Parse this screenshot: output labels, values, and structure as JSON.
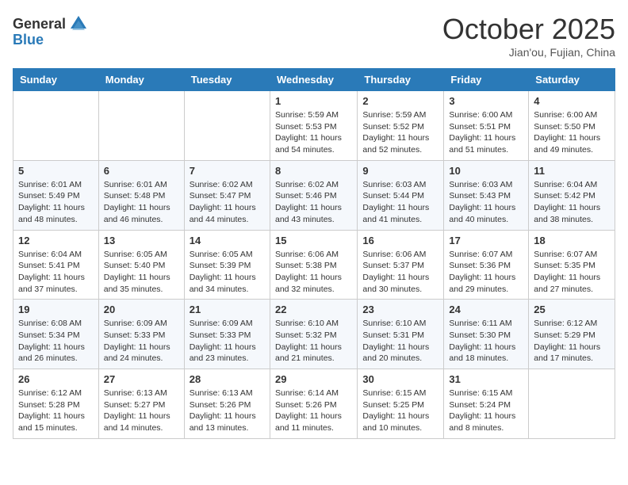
{
  "header": {
    "logo_general": "General",
    "logo_blue": "Blue",
    "month": "October 2025",
    "location": "Jian'ou, Fujian, China"
  },
  "weekdays": [
    "Sunday",
    "Monday",
    "Tuesday",
    "Wednesday",
    "Thursday",
    "Friday",
    "Saturday"
  ],
  "weeks": [
    [
      null,
      null,
      null,
      {
        "day": "1",
        "sunrise": "Sunrise: 5:59 AM",
        "sunset": "Sunset: 5:53 PM",
        "daylight": "Daylight: 11 hours and 54 minutes."
      },
      {
        "day": "2",
        "sunrise": "Sunrise: 5:59 AM",
        "sunset": "Sunset: 5:52 PM",
        "daylight": "Daylight: 11 hours and 52 minutes."
      },
      {
        "day": "3",
        "sunrise": "Sunrise: 6:00 AM",
        "sunset": "Sunset: 5:51 PM",
        "daylight": "Daylight: 11 hours and 51 minutes."
      },
      {
        "day": "4",
        "sunrise": "Sunrise: 6:00 AM",
        "sunset": "Sunset: 5:50 PM",
        "daylight": "Daylight: 11 hours and 49 minutes."
      }
    ],
    [
      {
        "day": "5",
        "sunrise": "Sunrise: 6:01 AM",
        "sunset": "Sunset: 5:49 PM",
        "daylight": "Daylight: 11 hours and 48 minutes."
      },
      {
        "day": "6",
        "sunrise": "Sunrise: 6:01 AM",
        "sunset": "Sunset: 5:48 PM",
        "daylight": "Daylight: 11 hours and 46 minutes."
      },
      {
        "day": "7",
        "sunrise": "Sunrise: 6:02 AM",
        "sunset": "Sunset: 5:47 PM",
        "daylight": "Daylight: 11 hours and 44 minutes."
      },
      {
        "day": "8",
        "sunrise": "Sunrise: 6:02 AM",
        "sunset": "Sunset: 5:46 PM",
        "daylight": "Daylight: 11 hours and 43 minutes."
      },
      {
        "day": "9",
        "sunrise": "Sunrise: 6:03 AM",
        "sunset": "Sunset: 5:44 PM",
        "daylight": "Daylight: 11 hours and 41 minutes."
      },
      {
        "day": "10",
        "sunrise": "Sunrise: 6:03 AM",
        "sunset": "Sunset: 5:43 PM",
        "daylight": "Daylight: 11 hours and 40 minutes."
      },
      {
        "day": "11",
        "sunrise": "Sunrise: 6:04 AM",
        "sunset": "Sunset: 5:42 PM",
        "daylight": "Daylight: 11 hours and 38 minutes."
      }
    ],
    [
      {
        "day": "12",
        "sunrise": "Sunrise: 6:04 AM",
        "sunset": "Sunset: 5:41 PM",
        "daylight": "Daylight: 11 hours and 37 minutes."
      },
      {
        "day": "13",
        "sunrise": "Sunrise: 6:05 AM",
        "sunset": "Sunset: 5:40 PM",
        "daylight": "Daylight: 11 hours and 35 minutes."
      },
      {
        "day": "14",
        "sunrise": "Sunrise: 6:05 AM",
        "sunset": "Sunset: 5:39 PM",
        "daylight": "Daylight: 11 hours and 34 minutes."
      },
      {
        "day": "15",
        "sunrise": "Sunrise: 6:06 AM",
        "sunset": "Sunset: 5:38 PM",
        "daylight": "Daylight: 11 hours and 32 minutes."
      },
      {
        "day": "16",
        "sunrise": "Sunrise: 6:06 AM",
        "sunset": "Sunset: 5:37 PM",
        "daylight": "Daylight: 11 hours and 30 minutes."
      },
      {
        "day": "17",
        "sunrise": "Sunrise: 6:07 AM",
        "sunset": "Sunset: 5:36 PM",
        "daylight": "Daylight: 11 hours and 29 minutes."
      },
      {
        "day": "18",
        "sunrise": "Sunrise: 6:07 AM",
        "sunset": "Sunset: 5:35 PM",
        "daylight": "Daylight: 11 hours and 27 minutes."
      }
    ],
    [
      {
        "day": "19",
        "sunrise": "Sunrise: 6:08 AM",
        "sunset": "Sunset: 5:34 PM",
        "daylight": "Daylight: 11 hours and 26 minutes."
      },
      {
        "day": "20",
        "sunrise": "Sunrise: 6:09 AM",
        "sunset": "Sunset: 5:33 PM",
        "daylight": "Daylight: 11 hours and 24 minutes."
      },
      {
        "day": "21",
        "sunrise": "Sunrise: 6:09 AM",
        "sunset": "Sunset: 5:33 PM",
        "daylight": "Daylight: 11 hours and 23 minutes."
      },
      {
        "day": "22",
        "sunrise": "Sunrise: 6:10 AM",
        "sunset": "Sunset: 5:32 PM",
        "daylight": "Daylight: 11 hours and 21 minutes."
      },
      {
        "day": "23",
        "sunrise": "Sunrise: 6:10 AM",
        "sunset": "Sunset: 5:31 PM",
        "daylight": "Daylight: 11 hours and 20 minutes."
      },
      {
        "day": "24",
        "sunrise": "Sunrise: 6:11 AM",
        "sunset": "Sunset: 5:30 PM",
        "daylight": "Daylight: 11 hours and 18 minutes."
      },
      {
        "day": "25",
        "sunrise": "Sunrise: 6:12 AM",
        "sunset": "Sunset: 5:29 PM",
        "daylight": "Daylight: 11 hours and 17 minutes."
      }
    ],
    [
      {
        "day": "26",
        "sunrise": "Sunrise: 6:12 AM",
        "sunset": "Sunset: 5:28 PM",
        "daylight": "Daylight: 11 hours and 15 minutes."
      },
      {
        "day": "27",
        "sunrise": "Sunrise: 6:13 AM",
        "sunset": "Sunset: 5:27 PM",
        "daylight": "Daylight: 11 hours and 14 minutes."
      },
      {
        "day": "28",
        "sunrise": "Sunrise: 6:13 AM",
        "sunset": "Sunset: 5:26 PM",
        "daylight": "Daylight: 11 hours and 13 minutes."
      },
      {
        "day": "29",
        "sunrise": "Sunrise: 6:14 AM",
        "sunset": "Sunset: 5:26 PM",
        "daylight": "Daylight: 11 hours and 11 minutes."
      },
      {
        "day": "30",
        "sunrise": "Sunrise: 6:15 AM",
        "sunset": "Sunset: 5:25 PM",
        "daylight": "Daylight: 11 hours and 10 minutes."
      },
      {
        "day": "31",
        "sunrise": "Sunrise: 6:15 AM",
        "sunset": "Sunset: 5:24 PM",
        "daylight": "Daylight: 11 hours and 8 minutes."
      },
      null
    ]
  ]
}
